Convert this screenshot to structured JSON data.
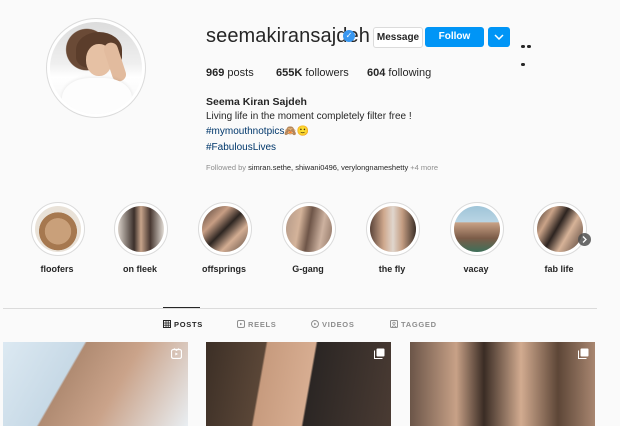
{
  "profile": {
    "username": "seemakiransajdeh",
    "verified_icon": "verified-badge-icon",
    "full_name": "Seema Kiran Sajdeh",
    "bio_line1": "Living life in the moment completely filter free !",
    "hashtag1": "#mymouthnotpics🙈🙂",
    "hashtag2": "#FabulousLives",
    "followed_by_prefix": "Followed by ",
    "followed_by_names": "simran.sethe, shiwani0496, verylongnameshetty",
    "followed_by_suffix": " +4 more"
  },
  "actions": {
    "message": "Message",
    "follow": "Follow",
    "dropdown_icon": "chevron-down-icon",
    "more_icon": "more-options-icon"
  },
  "stats": {
    "posts_count": "969",
    "posts_label": " posts",
    "followers_count": "655K",
    "followers_label": " followers",
    "following_count": "604",
    "following_label": " following"
  },
  "highlights": [
    {
      "label": "floofers"
    },
    {
      "label": "on fleek"
    },
    {
      "label": "offsprings"
    },
    {
      "label": "G-gang"
    },
    {
      "label": "the fly"
    },
    {
      "label": "vacay"
    },
    {
      "label": "fab life"
    }
  ],
  "tabs": [
    {
      "label": "POSTS",
      "icon": "grid-icon",
      "active": true
    },
    {
      "label": "REELS",
      "icon": "reels-icon",
      "active": false
    },
    {
      "label": "VIDEOS",
      "icon": "video-icon",
      "active": false
    },
    {
      "label": "TAGGED",
      "icon": "tagged-icon",
      "active": false
    }
  ],
  "colors": {
    "accent": "#0095f6",
    "background": "#fafafa",
    "link": "#00376b"
  }
}
